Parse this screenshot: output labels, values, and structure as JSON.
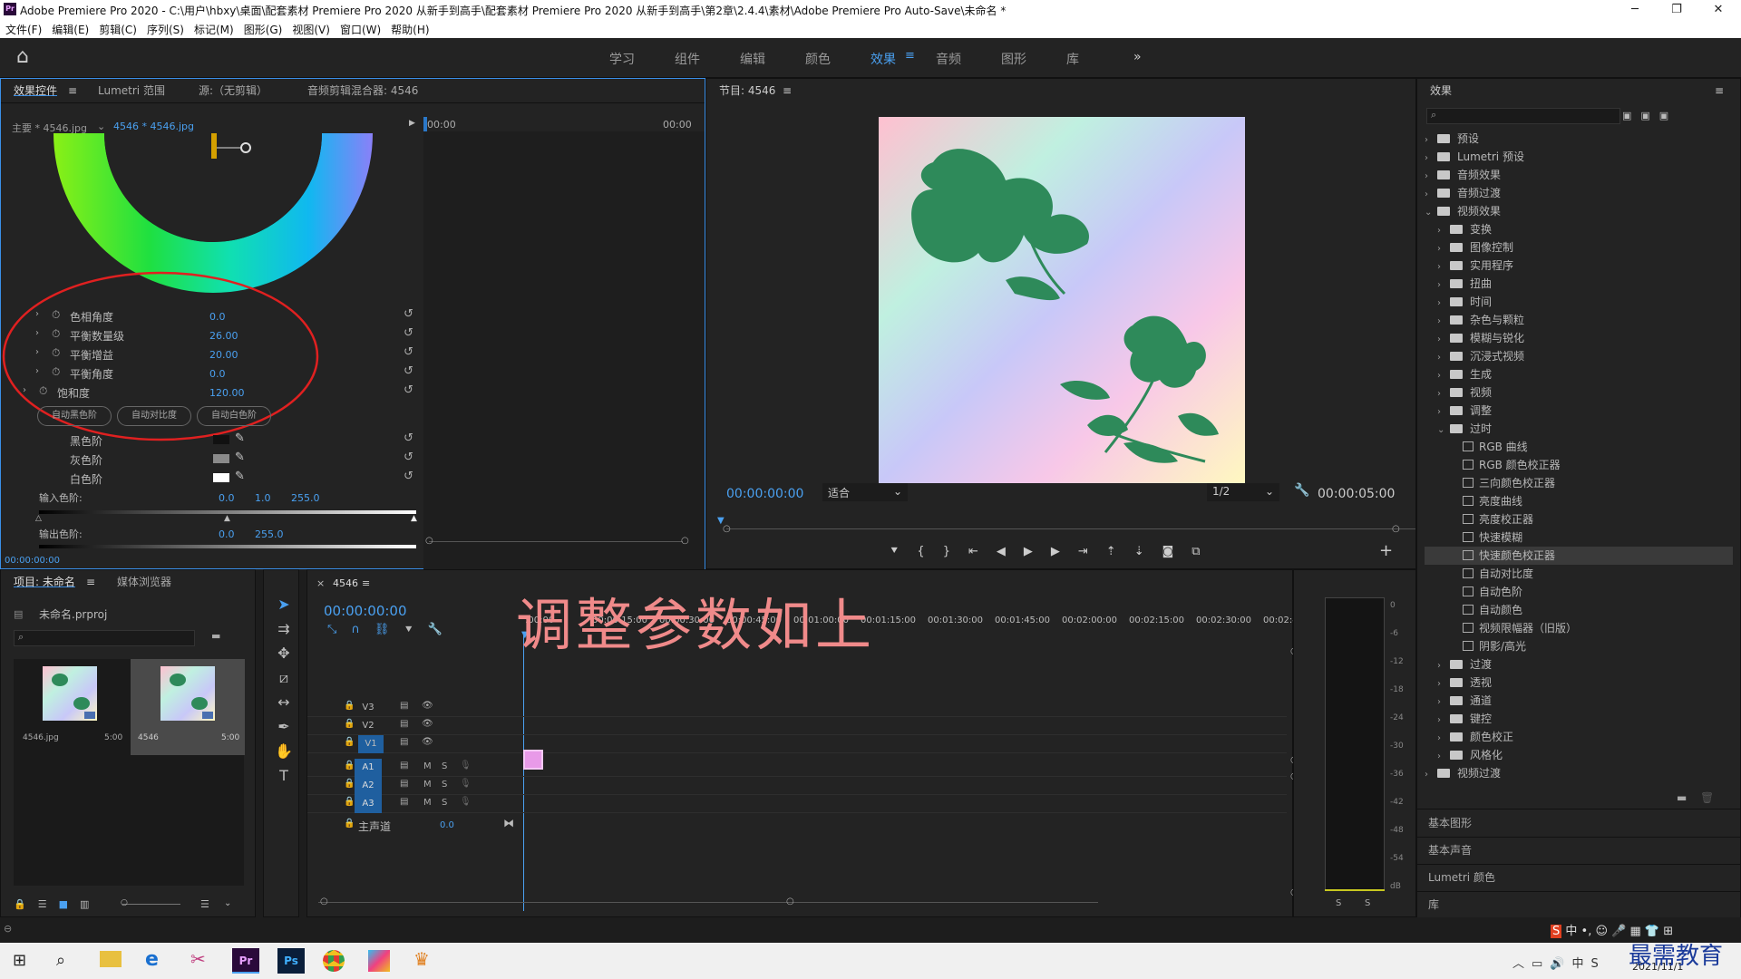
{
  "window": {
    "title": "Adobe Premiere Pro 2020 - C:\\用户\\hbxy\\桌面\\配套素材 Premiere Pro 2020 从新手到高手\\配套素材 Premiere Pro 2020 从新手到高手\\第2章\\2.4.4\\素材\\Adobe Premiere Pro Auto-Save\\未命名 *",
    "app_icon": "Pr",
    "min": "─",
    "max": "❐",
    "close": "✕"
  },
  "menu": [
    "文件(F)",
    "编辑(E)",
    "剪辑(C)",
    "序列(S)",
    "标记(M)",
    "图形(G)",
    "视图(V)",
    "窗口(W)",
    "帮助(H)"
  ],
  "workspaces": {
    "home": "⌂",
    "items": [
      "学习",
      "组件",
      "编辑",
      "颜色",
      "效果",
      "音频",
      "图形",
      "库"
    ],
    "active": "效果",
    "more": "»"
  },
  "effect_controls": {
    "tabs": [
      "效果控件",
      "Lumetri 范围",
      "源:（无剪辑）",
      "音频剪辑混合器: 4546"
    ],
    "master": "主要 * 4546.jpg",
    "clip": "4546 * 4546.jpg",
    "time_start": "00:00",
    "time_end": "00:00",
    "params": [
      {
        "label": "色相角度",
        "value": "0.0"
      },
      {
        "label": "平衡数量级",
        "value": "26.00"
      },
      {
        "label": "平衡增益",
        "value": "20.00"
      },
      {
        "label": "平衡角度",
        "value": "0.0"
      },
      {
        "label": "饱和度",
        "value": "120.00"
      }
    ],
    "buttons": [
      "自动黑色阶",
      "自动对比度",
      "自动白色阶"
    ],
    "levels": [
      {
        "label": "黑色阶",
        "color": "#111111"
      },
      {
        "label": "灰色阶",
        "color": "#8a8a8a"
      },
      {
        "label": "白色阶",
        "color": "#ffffff"
      }
    ],
    "input_label": "输入色阶:",
    "input_vals": [
      "0.0",
      "1.0",
      "255.0"
    ],
    "output_label": "输出色阶:",
    "output_vals": [
      "0.0",
      "255.0"
    ],
    "timecode": "00:00:00:00"
  },
  "program": {
    "title": "节目: 4546",
    "timecode": "00:00:00:00",
    "fit": "适合",
    "resolution": "1/2",
    "duration": "00:00:05:00"
  },
  "effects_panel": {
    "title": "效果",
    "items": [
      {
        "label": "预设",
        "level": 0,
        "type": "folder",
        "open": false
      },
      {
        "label": "Lumetri 预设",
        "level": 0,
        "type": "folder",
        "open": false
      },
      {
        "label": "音频效果",
        "level": 0,
        "type": "folder",
        "open": false
      },
      {
        "label": "音频过渡",
        "level": 0,
        "type": "folder",
        "open": false
      },
      {
        "label": "视频效果",
        "level": 0,
        "type": "folder",
        "open": true
      },
      {
        "label": "变换",
        "level": 1,
        "type": "folder",
        "open": false
      },
      {
        "label": "图像控制",
        "level": 1,
        "type": "folder",
        "open": false
      },
      {
        "label": "实用程序",
        "level": 1,
        "type": "folder",
        "open": false
      },
      {
        "label": "扭曲",
        "level": 1,
        "type": "folder",
        "open": false
      },
      {
        "label": "时间",
        "level": 1,
        "type": "folder",
        "open": false
      },
      {
        "label": "杂色与颗粒",
        "level": 1,
        "type": "folder",
        "open": false
      },
      {
        "label": "模糊与锐化",
        "level": 1,
        "type": "folder",
        "open": false
      },
      {
        "label": "沉浸式视频",
        "level": 1,
        "type": "folder",
        "open": false
      },
      {
        "label": "生成",
        "level": 1,
        "type": "folder",
        "open": false
      },
      {
        "label": "视频",
        "level": 1,
        "type": "folder",
        "open": false
      },
      {
        "label": "调整",
        "level": 1,
        "type": "folder",
        "open": false
      },
      {
        "label": "过时",
        "level": 1,
        "type": "folder",
        "open": true
      },
      {
        "label": "RGB 曲线",
        "level": 2,
        "type": "fx"
      },
      {
        "label": "RGB 颜色校正器",
        "level": 2,
        "type": "fx"
      },
      {
        "label": "三向颜色校正器",
        "level": 2,
        "type": "fx"
      },
      {
        "label": "亮度曲线",
        "level": 2,
        "type": "fx"
      },
      {
        "label": "亮度校正器",
        "level": 2,
        "type": "fx"
      },
      {
        "label": "快速模糊",
        "level": 2,
        "type": "fx"
      },
      {
        "label": "快速颜色校正器",
        "level": 2,
        "type": "fx",
        "selected": true
      },
      {
        "label": "自动对比度",
        "level": 2,
        "type": "fx"
      },
      {
        "label": "自动色阶",
        "level": 2,
        "type": "fx"
      },
      {
        "label": "自动颜色",
        "level": 2,
        "type": "fx"
      },
      {
        "label": "视频限幅器（旧版）",
        "level": 2,
        "type": "fx"
      },
      {
        "label": "阴影/高光",
        "level": 2,
        "type": "fx"
      },
      {
        "label": "过渡",
        "level": 1,
        "type": "folder",
        "open": false
      },
      {
        "label": "透视",
        "level": 1,
        "type": "folder",
        "open": false
      },
      {
        "label": "通道",
        "level": 1,
        "type": "folder",
        "open": false
      },
      {
        "label": "键控",
        "level": 1,
        "type": "folder",
        "open": false
      },
      {
        "label": "颜色校正",
        "level": 1,
        "type": "folder",
        "open": false
      },
      {
        "label": "风格化",
        "level": 1,
        "type": "folder",
        "open": false
      },
      {
        "label": "视频过渡",
        "level": 0,
        "type": "folder",
        "open": false
      }
    ],
    "sections": [
      "基本图形",
      "基本声音",
      "Lumetri 颜色",
      "库"
    ]
  },
  "project": {
    "tabs": [
      "项目: 未命名",
      "媒体浏览器"
    ],
    "file": "未命名.prproj",
    "clips": [
      {
        "name": "4546.jpg",
        "dur": "5:00"
      },
      {
        "name": "4546",
        "dur": "5:00"
      }
    ]
  },
  "timeline": {
    "seq": "4546",
    "timecode": "00:00:00:00",
    "ruler": [
      ":00:00",
      "00:00:15:00",
      "00:00:30:00",
      "00:00:45:00",
      "00:01:00:00",
      "00:01:15:00",
      "00:01:30:00",
      "00:01:45:00",
      "00:02:00:00",
      "00:02:15:00",
      "00:02:30:00",
      "00:02:45:"
    ],
    "video_tracks": [
      "V3",
      "V2",
      "V1"
    ],
    "audio_tracks": [
      "A1",
      "A2",
      "A3"
    ],
    "master": "主声道",
    "master_val": "0.0",
    "overlay": "调整参数如上"
  },
  "meter": {
    "ticks": [
      "0",
      "-6",
      "-12",
      "-18",
      "-24",
      "-30",
      "-36",
      "-42",
      "-48",
      "-54",
      "dB"
    ],
    "solo": [
      "S",
      "S"
    ]
  },
  "taskbar": {
    "date": "2021/11/1",
    "ime": "中",
    "watermark": "最需教育"
  }
}
